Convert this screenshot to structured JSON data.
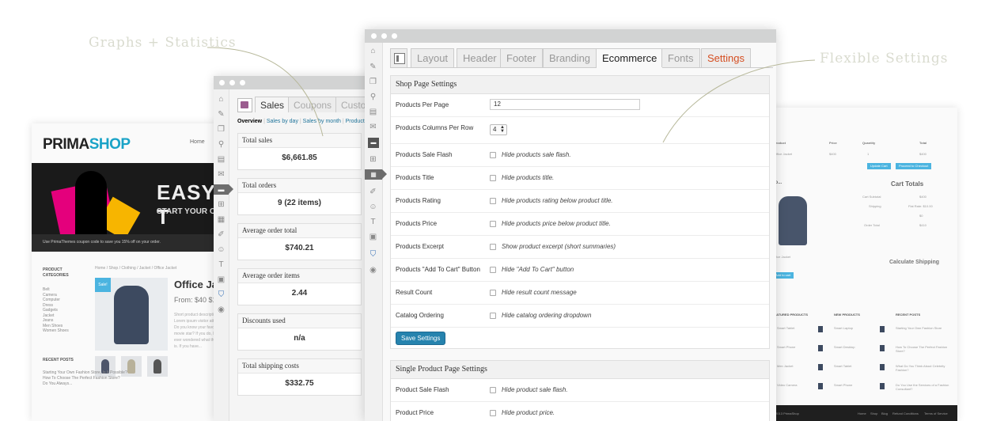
{
  "callouts": {
    "left": "Graphs + Statistics",
    "right": "Flexible Settings"
  },
  "storefront": {
    "logo_a": "PRIMA",
    "logo_b": "SHOP",
    "nav_home": "Home",
    "banner_line1": "EASY T",
    "banner_line2": "START YOUR ONL",
    "banner_strip": "Use PrimaThemes coupon code to save you 15% off on your order.",
    "categories_heading_1": "PRODUCT",
    "categories_heading_2": "CATEGORIES",
    "categories": [
      "Belt",
      "Camera",
      "Computer",
      "Dress",
      "Gadgets",
      "Jacket",
      "Jeans",
      "Men Shoes",
      "Women Shoes"
    ],
    "breadcrumb": "Home / Shop / Clothing / Jacket / Office Jacket",
    "sale_badge": "Sale!",
    "product_title": "Office Ja",
    "product_price": "From: $40 $1",
    "product_desc": "Short product description here. Lorem ipsum visitor attention. Do you know your favorite movie star? If you do, have you ever wondered what the secret is. If you have...",
    "recent_heading": "RECENT POSTS",
    "recent_posts": [
      "Starting Your Own Fashion Store, Is It Possible?",
      "How To Choose The Perfect Fashion Store?",
      "Do You Always..."
    ]
  },
  "cart": {
    "headers": [
      "Product",
      "Price",
      "Quantity",
      "Total"
    ],
    "row": [
      "Office Jacket",
      "$400",
      "1",
      "$400"
    ],
    "buttons": [
      "Update Cart",
      "Proceed to Checkout"
    ],
    "totals_title": "Cart Totals",
    "cross_title": "Yo...",
    "totals_rows": [
      [
        "Cart Subtotal",
        "$400"
      ],
      [
        "Shipping",
        "Flat Rate: $10.00"
      ],
      [
        "",
        "$0"
      ],
      [
        "Order Total",
        "$410"
      ]
    ],
    "calc_title": "Calculate Shipping",
    "product_name": "Office Jacket",
    "add_to_cart": "Add to cart",
    "col_titles": [
      "FEATURED PRODUCTS",
      "NEW PRODUCTS",
      "RECENT POSTS"
    ],
    "col1": [
      "Smart Tablet",
      "Smart Phone",
      "Men Jacket",
      "Video Camera"
    ],
    "col2": [
      "Smart Laptop",
      "Smart Desktop",
      "Smart Tablet",
      "Smart Phone"
    ],
    "col3": [
      "Starting Your Own Fashion Store",
      "How To Choose The Perfect Fashion Store?",
      "What Do You Think About Celebrity Fashion?",
      "Do You Use the Services of a Fashion Consultant?"
    ],
    "footer_links": [
      "© 2013 PrimaShop",
      "Home",
      "Shop",
      "Blog",
      "Refund Conditions",
      "Terms of Service"
    ]
  },
  "reports": {
    "tabs": [
      "Sales",
      "Coupons",
      "Custo"
    ],
    "subnav": {
      "current": "Overview",
      "links": [
        "Sales by day",
        "Sales by month",
        "Product S"
      ]
    },
    "stats": [
      {
        "label": "Total sales",
        "value": "$6,661.85"
      },
      {
        "label": "Total orders",
        "value": "9 (22 items)"
      },
      {
        "label": "Average order total",
        "value": "$740.21"
      },
      {
        "label": "Average order items",
        "value": "2.44"
      },
      {
        "label": "Discounts used",
        "value": "n/a"
      },
      {
        "label": "Total shipping costs",
        "value": "$332.75"
      }
    ]
  },
  "settings": {
    "tabs": [
      "Layout",
      "Header",
      "Footer",
      "Branding",
      "Ecommerce",
      "Fonts",
      "Settings"
    ],
    "active_tab": "Ecommerce",
    "shop_panel": {
      "title": "Shop Page Settings",
      "products_per_page": {
        "label": "Products Per Page",
        "value": "12"
      },
      "columns_per_row": {
        "label": "Products Columns Per Row",
        "value": "4"
      },
      "checkbox_rows": [
        {
          "label": "Products Sale Flash",
          "text": "Hide products sale flash."
        },
        {
          "label": "Products Title",
          "text": "Hide products title."
        },
        {
          "label": "Products Rating",
          "text": "Hide products rating below product title."
        },
        {
          "label": "Products Price",
          "text": "Hide products price below product title."
        },
        {
          "label": "Products Excerpt",
          "text": "Show product excerpt (short summaries)"
        },
        {
          "label": "Products \"Add To Cart\" Button",
          "text": "Hide \"Add To Cart\" button"
        },
        {
          "label": "Result Count",
          "text": "Hide result count message"
        },
        {
          "label": "Catalog Ordering",
          "text": "Hide catalog ordering dropdown"
        }
      ],
      "save_label": "Save Settings"
    },
    "single_panel": {
      "title": "Single Product Page Settings",
      "checkbox_rows": [
        {
          "label": "Product Sale Flash",
          "text": "Hide product sale flash."
        },
        {
          "label": "Product Price",
          "text": "Hide product price."
        }
      ]
    }
  },
  "sidebar_icons": [
    "dashboard-icon",
    "pin-icon",
    "media-icon",
    "links-icon",
    "pages-icon",
    "comments-icon",
    "woocommerce-icon",
    "products-icon",
    "reports-icon",
    "appearance-icon",
    "users-icon",
    "tools-icon",
    "settings-icon",
    "shield-icon",
    "collapse-icon"
  ]
}
